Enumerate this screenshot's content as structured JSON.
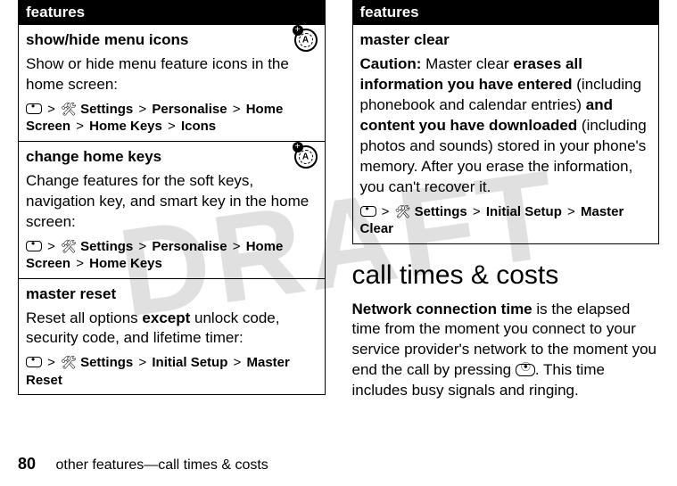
{
  "watermark": "DRAFT",
  "left_table": {
    "header": "features",
    "rows": [
      {
        "title": "show/hide menu icons",
        "has_badge": true,
        "body": "Show or hide menu feature icons in the home screen:",
        "path_parts": [
          "Settings",
          "Personalise",
          "Home Screen",
          "Home Keys",
          "Icons"
        ]
      },
      {
        "title": "change home keys",
        "has_badge": true,
        "body": "Change features for the soft keys, navigation key, and smart key in the home screen:",
        "path_parts": [
          "Settings",
          "Personalise",
          "Home Screen",
          "Home Keys"
        ]
      },
      {
        "title": "master reset",
        "has_badge": false,
        "body_html": "Reset all options <b>except</b> unlock code, security code, and lifetime timer:",
        "path_parts": [
          "Settings",
          "Initial Setup",
          "Master Reset"
        ]
      }
    ]
  },
  "right_table": {
    "header": "features",
    "rows": [
      {
        "title": "master clear",
        "has_badge": false,
        "caution_label": "Caution:",
        "body_parts": {
          "p1": " Master clear ",
          "b1": "erases all information you have entered",
          "p2": " (including phonebook and calendar entries) ",
          "b2": "and content you have downloaded",
          "p3": " (including photos and sounds) stored in your phone's memory. After you erase the information, you can't recover it."
        },
        "path_parts": [
          "Settings",
          "Initial Setup",
          "Master Clear"
        ]
      }
    ]
  },
  "section_heading": "call times & costs",
  "section_body": {
    "b1": "Network connection time",
    "p1": " is the elapsed time from the moment you connect to your service provider's network to the moment you end the call by pressing ",
    "p2": ". This time includes busy signals and ringing."
  },
  "footer": {
    "page": "80",
    "text": "other features—call times & costs"
  },
  "gt": ">"
}
